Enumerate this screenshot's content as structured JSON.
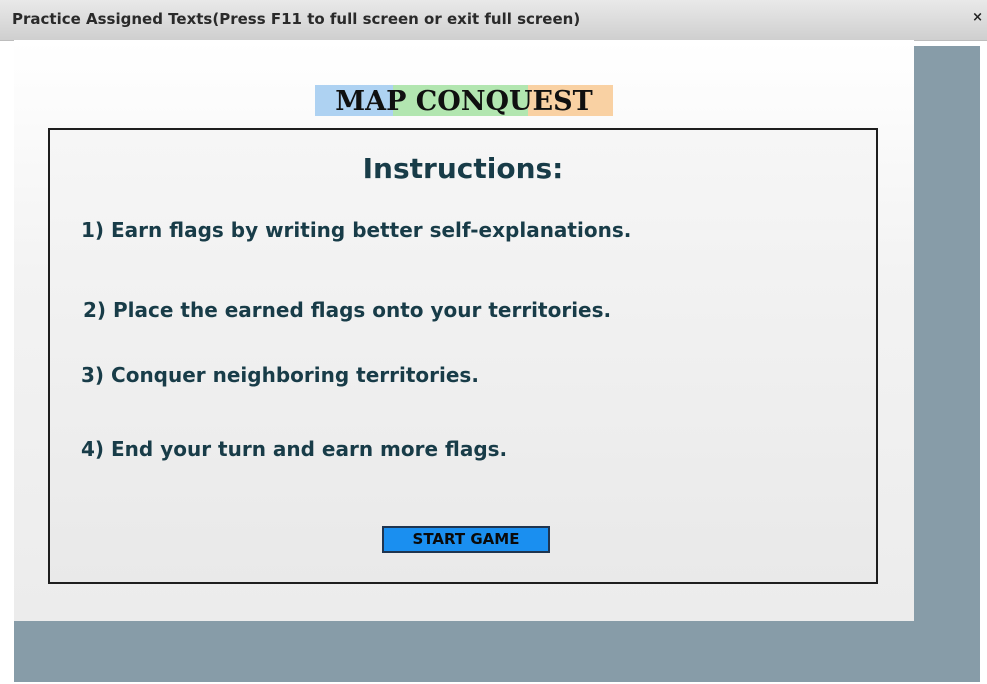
{
  "window": {
    "title": "Practice Assigned Texts(Press F11 to full screen or exit full screen)",
    "close_symbol": "×"
  },
  "game": {
    "logo_text": "MAP CONQUEST",
    "logo_colors": [
      "#aed2f2",
      "#b2e6b0",
      "#f9d1a3"
    ],
    "heading": "Instructions:",
    "steps": [
      "1) Earn flags by writing better self-explanations.",
      "2) Place the earned flags onto your territories.",
      "3) Conquer neighboring territories.",
      "4) End your turn and earn more flags."
    ],
    "start_label": "START GAME",
    "start_color": "#1a8ff0"
  },
  "theme": {
    "frame_color": "#879ca8",
    "text_color": "#183c48"
  }
}
